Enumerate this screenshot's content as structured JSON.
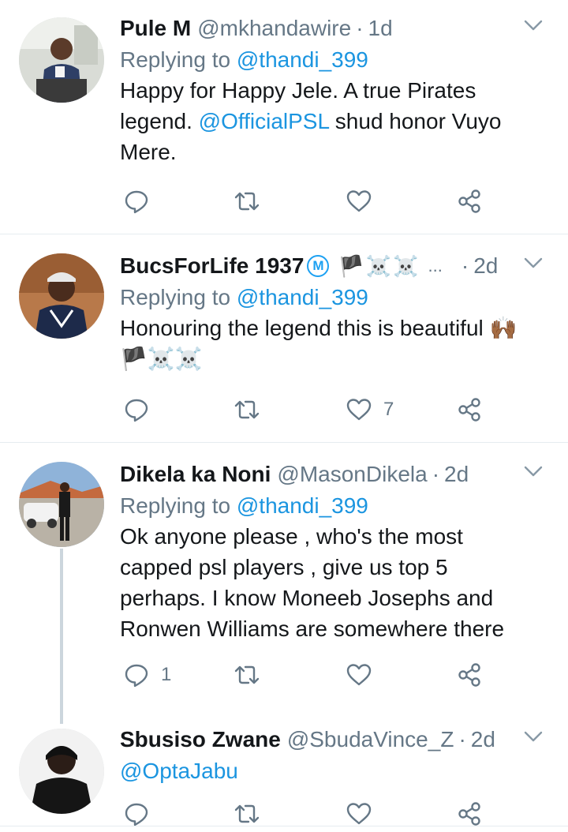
{
  "colors": {
    "link": "#1b95e0",
    "muted": "#657786",
    "text": "#14171a",
    "divider": "#e6ecf0",
    "thread_line": "#ccd6dd"
  },
  "tweets": [
    {
      "name": "Pule M",
      "handle": "@mkhandawire",
      "dot": "·",
      "time": "1d",
      "replying_prefix": "Replying to",
      "replying_to": "@thandi_399",
      "body_1": "Happy for Happy Jele. A true Pirates legend. ",
      "mention": "@OfficialPSL",
      "body_2": " shud honor Vuyo Mere.",
      "reply_count": "",
      "like_count": ""
    },
    {
      "name": "BucsForLife 1937",
      "verified_badge": "M",
      "name_emoji": "🏴☠️☠️",
      "ellipsis": "...",
      "handle": "",
      "dot": "·",
      "time": "2d",
      "replying_prefix": "Replying to",
      "replying_to": "@thandi_399",
      "body": "Honouring the legend this is beautiful 🙌🏾 🏴☠️☠️",
      "reply_count": "",
      "like_count": "7"
    },
    {
      "name": "Dikela ka Noni",
      "handle": "@MasonDikela",
      "dot": "·",
      "time": "2d",
      "replying_prefix": "Replying to",
      "replying_to": "@thandi_399",
      "body": "Ok anyone please , who's the most capped psl players , give us top 5 perhaps.  I know Moneeb Josephs and Ronwen Williams are somewhere there",
      "reply_count": "1",
      "like_count": ""
    },
    {
      "name": "Sbusiso Zwane",
      "handle": "@SbudaVince_Z",
      "dot": "·",
      "time": "2d",
      "mention": "@OptaJabu",
      "reply_count": "",
      "like_count": ""
    }
  ]
}
